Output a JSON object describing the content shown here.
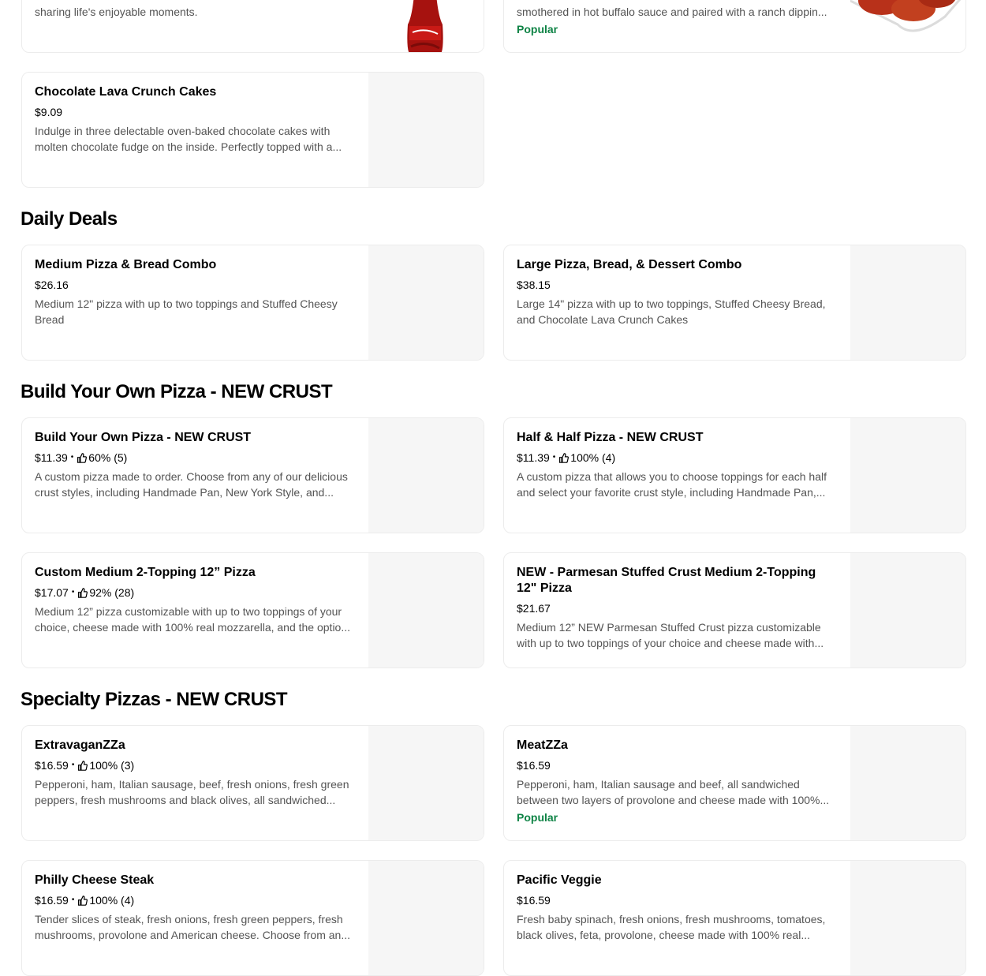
{
  "top_partial": {
    "left_desc": "sharing life's enjoyable moments.",
    "right_desc": "smothered in hot buffalo sauce and paired with a ranch dippin...",
    "right_badge": "Popular"
  },
  "desserts": {
    "item": {
      "name": "Chocolate Lava Crunch Cakes",
      "price": "$9.09",
      "desc": "Indulge in three delectable oven-baked chocolate cakes with molten chocolate fudge on the inside. Perfectly topped with a..."
    }
  },
  "daily_deals": {
    "title": "Daily Deals",
    "items": [
      {
        "name": "Medium Pizza & Bread Combo",
        "price": "$26.16",
        "desc": "Medium 12\" pizza with up to two toppings and Stuffed Cheesy Bread"
      },
      {
        "name": "Large Pizza, Bread, & Dessert Combo",
        "price": "$38.15",
        "desc": "Large 14\" pizza with up to two toppings, Stuffed Cheesy Bread, and Chocolate Lava Crunch Cakes"
      }
    ]
  },
  "build_your_own": {
    "title": "Build Your Own Pizza - NEW CRUST",
    "items": [
      {
        "name": "Build Your Own Pizza - NEW CRUST",
        "price": "$11.39",
        "rating": "60% (5)",
        "desc": "A custom pizza made to order. Choose from any of our delicious crust styles, including Handmade Pan, New York Style, and..."
      },
      {
        "name": "Half & Half Pizza - NEW CRUST",
        "price": "$11.39",
        "rating": "100% (4)",
        "desc": "A custom pizza that allows you to choose toppings for each half and select your favorite crust style, including Handmade Pan,..."
      },
      {
        "name": "Custom Medium 2-Topping 12” Pizza",
        "price": "$17.07",
        "rating": "92% (28)",
        "desc": "Medium 12” pizza customizable with up to two toppings of your choice, cheese made with 100% real mozzarella, and the optio..."
      },
      {
        "name": "NEW - Parmesan Stuffed Crust Medium 2-Topping 12\" Pizza",
        "price": "$21.67",
        "desc": "Medium 12” NEW Parmesan Stuffed Crust pizza customizable with up to two toppings of your choice and cheese made with..."
      }
    ]
  },
  "specialty": {
    "title": "Specialty Pizzas - NEW CRUST",
    "items": [
      {
        "name": "ExtravaganZZa",
        "price": "$16.59",
        "rating": "100% (3)",
        "desc": "Pepperoni, ham, Italian sausage, beef, fresh onions, fresh green peppers, fresh mushrooms and black olives, all sandwiched..."
      },
      {
        "name": "MeatZZa",
        "price": "$16.59",
        "desc": "Pepperoni, ham, Italian sausage and beef, all sandwiched between two layers of provolone and cheese made with 100%...",
        "badge": "Popular"
      },
      {
        "name": "Philly Cheese Steak",
        "price": "$16.59",
        "rating": "100% (4)",
        "desc": "Tender slices of steak, fresh onions, fresh green peppers, fresh mushrooms, provolone and American cheese. Choose from an..."
      },
      {
        "name": "Pacific Veggie",
        "price": "$16.59",
        "desc": "Fresh baby spinach, fresh onions, fresh mushrooms, tomatoes, black olives, feta, provolone, cheese made with 100% real..."
      }
    ]
  },
  "colors": {
    "popular": "#0e8345",
    "card_border": "#ececec",
    "image_bg": "#f6f6f6",
    "desc_text": "#545454"
  },
  "icons": {
    "rating": "thumbs-up-icon",
    "separator": "bullet"
  }
}
